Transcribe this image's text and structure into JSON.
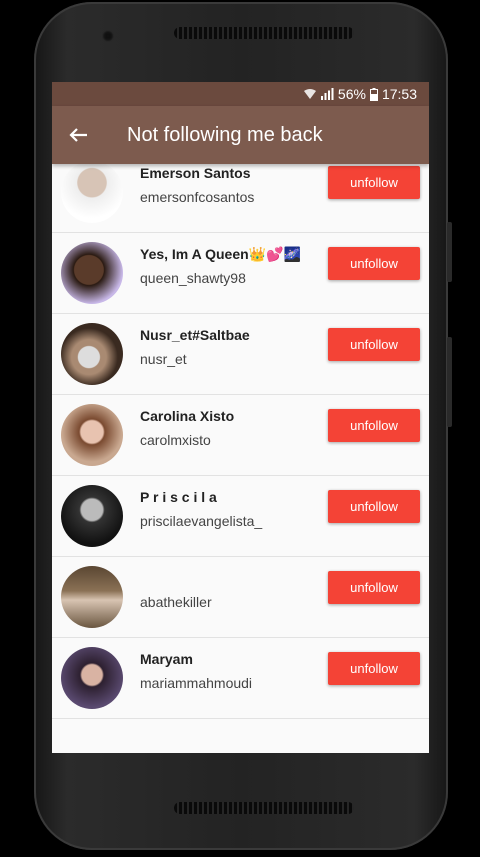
{
  "status_bar": {
    "battery": "56%",
    "time": "17:53"
  },
  "app_bar": {
    "title": "Not following me back"
  },
  "list": [
    {
      "name": "Emerson Santos",
      "handle": "emersonfcosantos",
      "button": "unfollow"
    },
    {
      "name": "Yes, Im A Queen👑💕🌌",
      "handle": "queen_shawty98",
      "button": "unfollow"
    },
    {
      "name": "Nusr_et#Saltbae",
      "handle": "nusr_et",
      "button": "unfollow"
    },
    {
      "name": "Carolina Xisto",
      "handle": "carolmxisto",
      "button": "unfollow"
    },
    {
      "name": "P r i s c i l a",
      "handle": "priscilaevangelista_",
      "button": "unfollow"
    },
    {
      "name": "",
      "handle": "abathekiller",
      "button": "unfollow"
    },
    {
      "name": "Maryam",
      "handle": "mariammahmoudi",
      "button": "unfollow"
    }
  ],
  "colors": {
    "status_bar": "#6b4a3e",
    "app_bar": "#7d5b4e",
    "unfollow_button": "#f44336"
  }
}
